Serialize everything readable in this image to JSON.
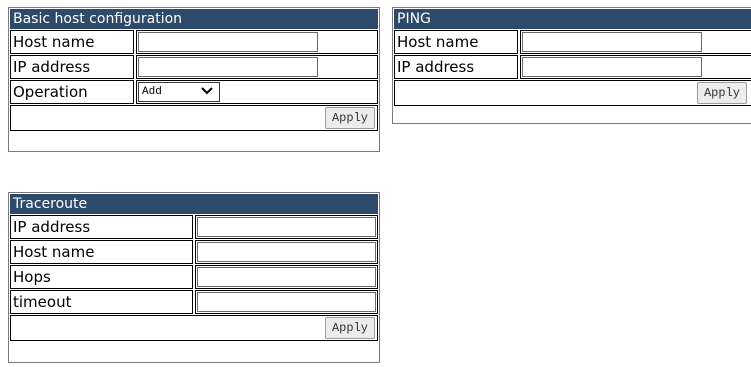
{
  "basic_host": {
    "title": "Basic host configuration",
    "host_name_label": "Host name",
    "host_name_value": "",
    "ip_address_label": "IP address",
    "ip_address_value": "",
    "operation_label": "Operation",
    "operation_selected": "Add",
    "apply_label": "Apply"
  },
  "ping": {
    "title": "PING",
    "host_name_label": "Host name",
    "host_name_value": "",
    "ip_address_label": "IP address",
    "ip_address_value": "",
    "apply_label": "Apply"
  },
  "traceroute": {
    "title": "Traceroute",
    "ip_address_label": "IP address",
    "ip_address_value": "",
    "host_name_label": "Host name",
    "host_name_value": "",
    "hops_label": "Hops",
    "hops_value": "",
    "timeout_label": "timeout",
    "timeout_value": "",
    "apply_label": "Apply"
  },
  "colors": {
    "title_bar": "#2d4a6b",
    "title_text": "#ffffff",
    "button_bg": "#ececec"
  }
}
